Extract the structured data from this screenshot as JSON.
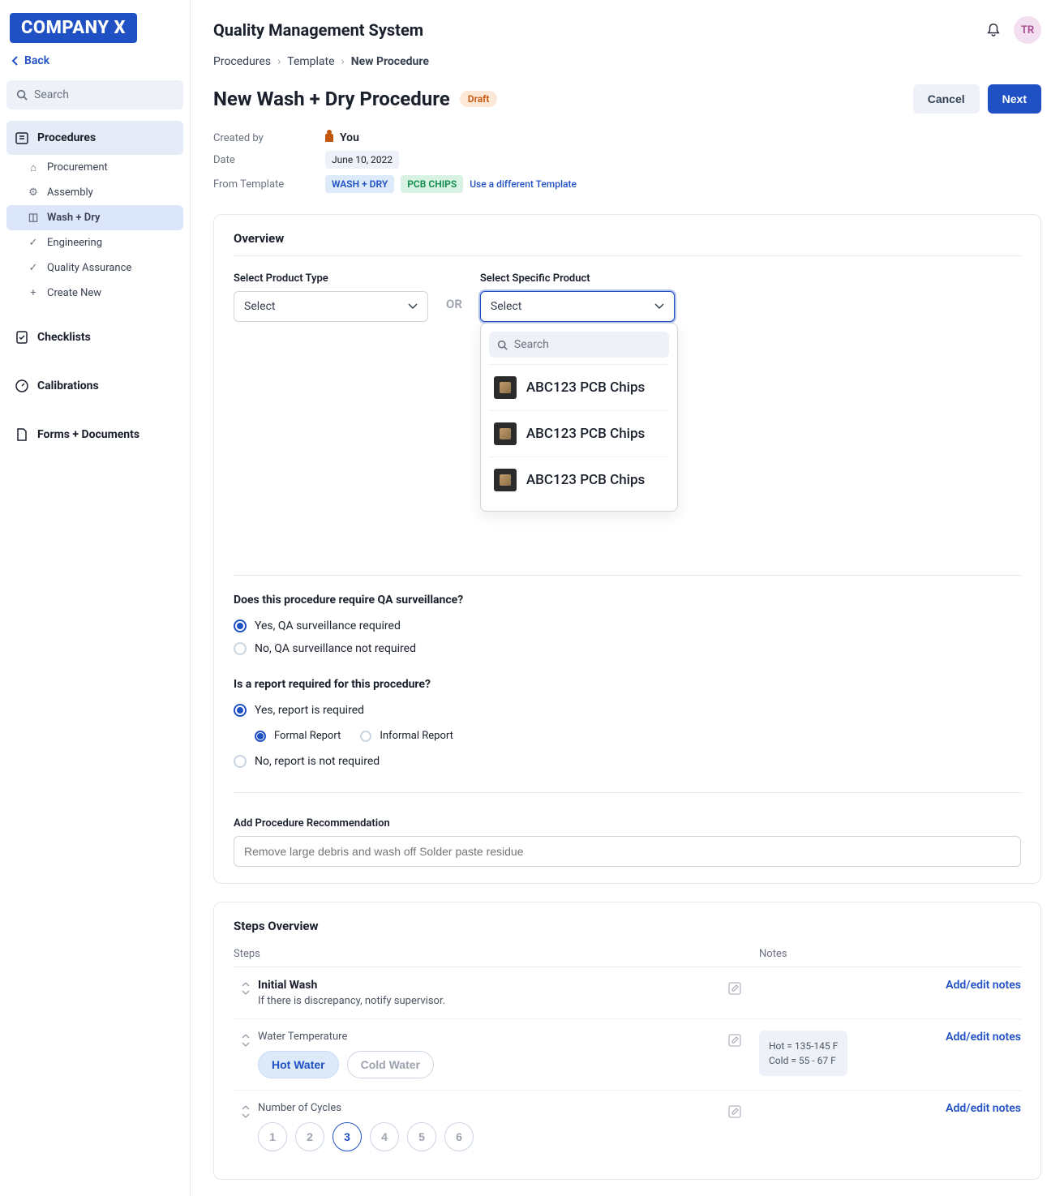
{
  "brand": "COMPANY X",
  "back_label": "Back",
  "search_placeholder": "Search",
  "sidebar": {
    "items": [
      {
        "label": "Procedures",
        "active": true
      },
      {
        "label": "Checklists"
      },
      {
        "label": "Calibrations"
      },
      {
        "label": "Forms + Documents"
      }
    ],
    "sub": [
      {
        "label": "Procurement"
      },
      {
        "label": "Assembly"
      },
      {
        "label": "Wash + Dry",
        "active": true
      },
      {
        "label": "Engineering"
      },
      {
        "label": "Quality Assurance"
      },
      {
        "label": "Create New"
      }
    ]
  },
  "header": {
    "title": "Quality Management System",
    "avatar": "TR"
  },
  "breadcrumb": [
    "Procedures",
    "Template",
    "New Procedure"
  ],
  "page": {
    "title": "New Wash + Dry Procedure",
    "badge": "Draft",
    "cancel": "Cancel",
    "next": "Next"
  },
  "meta": {
    "created_by_label": "Created by",
    "created_by_value": "You",
    "date_label": "Date",
    "date_value": "June 10, 2022",
    "from_label": "From Template",
    "template1": "WASH + DRY",
    "template2": "PCB CHIPS",
    "change_link": "Use a different Template"
  },
  "overview": {
    "title": "Overview",
    "product_type_label": "Select Product Type",
    "or_text": "OR",
    "specific_label": "Select Specific Product",
    "select_placeholder": "Select",
    "dropdown_search": "Search",
    "dropdown_items": [
      {
        "name": "ABC123 PCB Chips"
      },
      {
        "name": "ABC123 PCB Chips"
      },
      {
        "name": "ABC123 PCB Chips"
      }
    ],
    "qa_question": "Does this procedure require QA surveillance?",
    "qa_yes": "Yes, QA surveillance required",
    "qa_no": "No, QA surveillance not required",
    "report_question": "Is a report required for this procedure?",
    "report_yes": "Yes, report is required",
    "report_formal": "Formal Report",
    "report_informal": "Informal Report",
    "report_no": "No, report is not required",
    "rec_label": "Add Procedure Recommendation",
    "rec_placeholder": "Remove large debris and wash off Solder paste residue"
  },
  "steps": {
    "title": "Steps Overview",
    "col_steps": "Steps",
    "col_notes": "Notes",
    "add_notes": "Add/edit notes",
    "rows": [
      {
        "name": "Initial Wash",
        "desc": "If there is discrepancy, notify supervisor."
      },
      {
        "name": "Water Temperature",
        "options": [
          "Hot Water",
          "Cold Water"
        ],
        "selected": 0,
        "notes": [
          "Hot = 135-145 F",
          "Cold = 55 - 67 F"
        ]
      },
      {
        "name": "Number of Cycles",
        "cycles": [
          "1",
          "2",
          "3",
          "4",
          "5",
          "6"
        ],
        "selected_cycle": 2
      }
    ]
  }
}
